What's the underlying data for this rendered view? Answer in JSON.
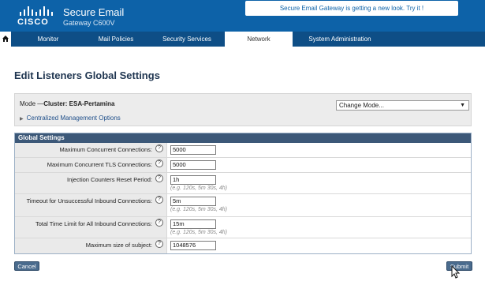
{
  "header": {
    "logo_text": "CISCO",
    "product_name": "Secure Email",
    "product_model": "Gateway C600V",
    "notice": "Secure Email Gateway is getting a new look. Try it !"
  },
  "nav": {
    "home_icon": "home-icon",
    "tabs": [
      {
        "label": "Monitor"
      },
      {
        "label": "Mail Policies"
      },
      {
        "label": "Security Services"
      },
      {
        "label": "Network"
      },
      {
        "label": "System Administration"
      }
    ],
    "active": "Network"
  },
  "page": {
    "title": "Edit Listeners Global Settings"
  },
  "mode": {
    "label_prefix": "Mode —",
    "label_value": "Cluster: ESA-Pertamina",
    "change_mode": "Change Mode...",
    "centralized": "Centralized Management Options"
  },
  "global_settings": {
    "heading": "Global Settings",
    "rows": [
      {
        "label": "Maximum Concurrent Connections:",
        "value": "5000",
        "hint": ""
      },
      {
        "label": "Maximum Concurrent TLS Connections:",
        "value": "5000",
        "hint": ""
      },
      {
        "label": "Injection Counters Reset Period:",
        "value": "1h",
        "hint": "(e.g. 120s, 5m 30s, 4h)"
      },
      {
        "label": "Timeout for Unsuccessful Inbound Connections:",
        "value": "5m",
        "hint": "(e.g. 120s, 5m 30s, 4h)"
      },
      {
        "label": "Total Time Limit for All Inbound Connections:",
        "value": "15m",
        "hint": "(e.g. 120s, 5m 30s, 4h)"
      },
      {
        "label": "Maximum size of subject:",
        "value": "1048576",
        "hint": ""
      }
    ],
    "help_glyph": "?"
  },
  "actions": {
    "cancel": "Cancel",
    "submit": "Submit"
  },
  "colors": {
    "header_blue": "#0d62a8",
    "nav_blue": "#0e4e86",
    "section_head": "#3c5878",
    "button": "#4a6b8d"
  }
}
